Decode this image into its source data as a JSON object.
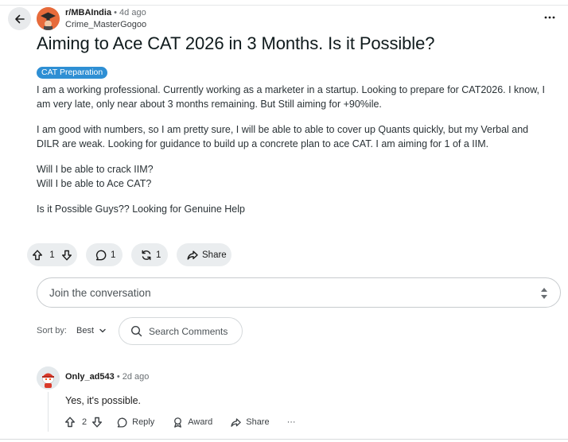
{
  "post": {
    "subreddit": "r/MBAIndia",
    "time": "4d ago",
    "separator": "•",
    "author": "Crime_MasterGogoo",
    "title": "Aiming to Ace CAT 2026 in 3 Months. Is it Possible?",
    "flair": "CAT Preparation",
    "paragraphs": {
      "p1": "I am a working professional. Currently working as a marketer in a startup. Looking to prepare for CAT2026. I know, I am very late, only near about 3 months remaining. But Still aiming for +90%ile.",
      "p2": "I am good with numbers, so I am pretty sure, I will be able to able to cover up Quants quickly, but my Verbal and DILR are weak. Looking for guidance to build up a concrete plan to ace CAT. I am aiming for 1 of a IIM.",
      "p3a": "Will I be able to crack IIM?",
      "p3b": "Will I be able to Ace CAT?",
      "p4": "Is it Possible Guys?? Looking for Genuine Help"
    },
    "votes": "1",
    "comments": "1",
    "crossposts": "1",
    "share_label": "Share"
  },
  "comment_box": {
    "placeholder": "Join the conversation"
  },
  "sort": {
    "label": "Sort by:",
    "value": "Best"
  },
  "search_comments": {
    "placeholder": "Search Comments"
  },
  "comment": {
    "user": "Only_ad543",
    "separator": "•",
    "time": "2d ago",
    "text": "Yes, it's possible.",
    "votes": "2",
    "reply_label": "Reply",
    "award_label": "Award",
    "share_label": "Share",
    "more_label": "···"
  },
  "colors": {
    "flair_bg": "#2e8fd4",
    "subreddit_avatar": "#e76b3b",
    "pill_bg": "#eaedef"
  }
}
